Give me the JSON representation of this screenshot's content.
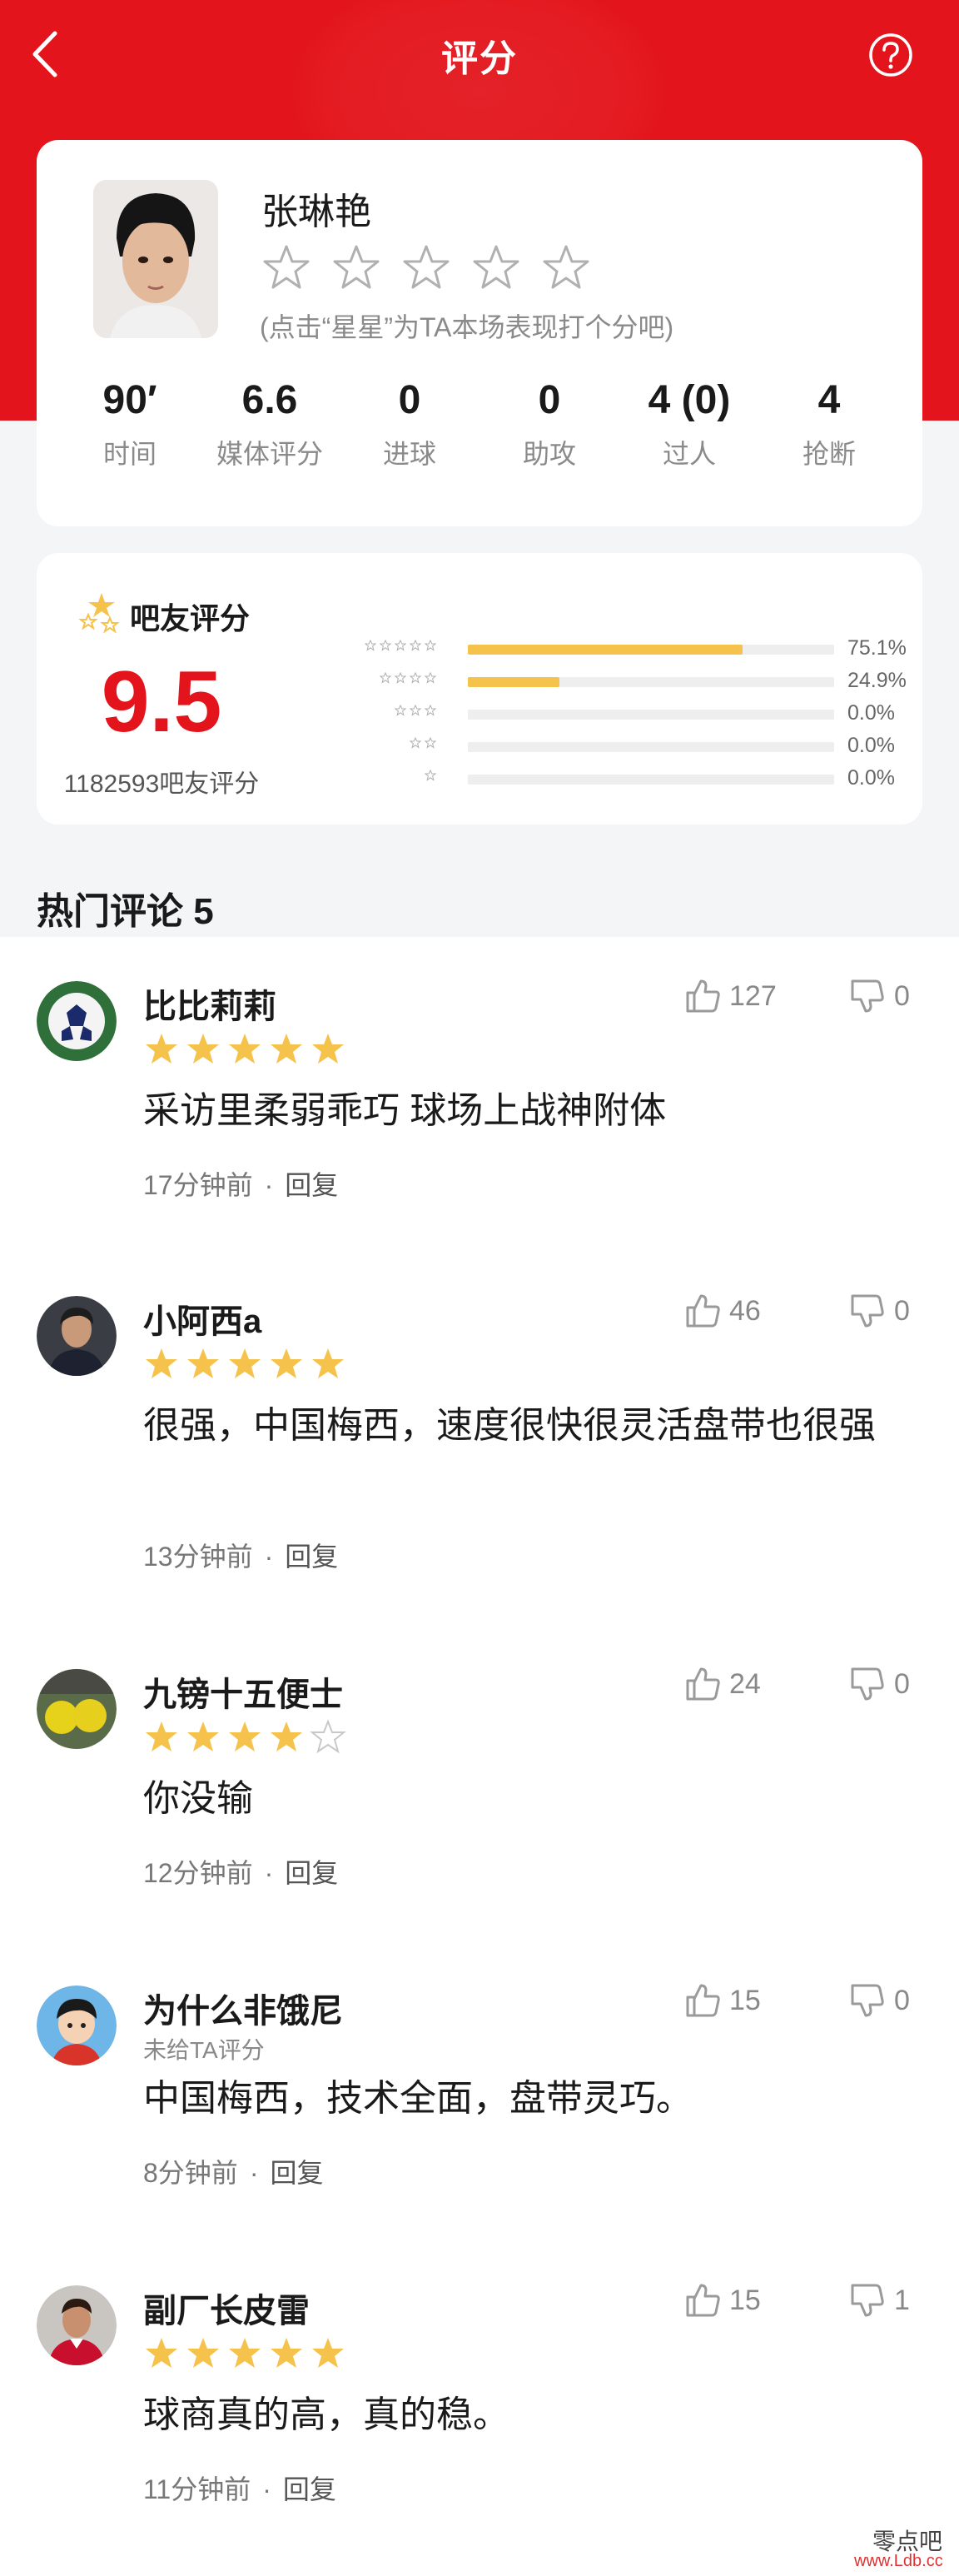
{
  "nav": {
    "title": "评分"
  },
  "player": {
    "name": "张琳艳",
    "hint": "(点击“星星”为TA本场表现打个分吧)",
    "stats": [
      {
        "value": "90′",
        "label": "时间"
      },
      {
        "value": "6.6",
        "label": "媒体评分"
      },
      {
        "value": "0",
        "label": "进球"
      },
      {
        "value": "0",
        "label": "助攻"
      },
      {
        "value": "4 (0)",
        "label": "过人"
      },
      {
        "value": "4",
        "label": "抢断"
      }
    ]
  },
  "fan": {
    "title": "吧友评分",
    "score": "9.5",
    "count": "1182593吧友评分",
    "distribution": [
      {
        "stars": 5,
        "fraction": 0.751,
        "pct": "75.1%"
      },
      {
        "stars": 4,
        "fraction": 0.249,
        "pct": "24.9%"
      },
      {
        "stars": 3,
        "fraction": 0.0,
        "pct": "0.0%"
      },
      {
        "stars": 2,
        "fraction": 0.0,
        "pct": "0.0%"
      },
      {
        "stars": 1,
        "fraction": 0.0,
        "pct": "0.0%"
      }
    ]
  },
  "hot": {
    "title": "热门评论 5"
  },
  "comments": [
    {
      "name": "比比莉莉",
      "rating": 5,
      "text": "采访里柔弱乖巧 球场上战神附体",
      "time": "17分钟前",
      "reply": "回复",
      "likes": "127",
      "dislikes": "0"
    },
    {
      "name": "小阿西a",
      "rating": 5,
      "text": "很强，中国梅西，速度很快很灵活盘带也很强",
      "time": "13分钟前",
      "reply": "回复",
      "likes": "46",
      "dislikes": "0"
    },
    {
      "name": "九镑十五便士",
      "rating": 4,
      "text": "你没输",
      "time": "12分钟前",
      "reply": "回复",
      "likes": "24",
      "dislikes": "0"
    },
    {
      "name": "为什么非饿尼",
      "sub": "未给TA评分",
      "text": "中国梅西，技术全面，盘带灵巧。",
      "time": "8分钟前",
      "reply": "回复",
      "likes": "15",
      "dislikes": "0"
    },
    {
      "name": "副厂长皮雷",
      "rating": 5,
      "text": "球商真的高，真的稳。",
      "time": "11分钟前",
      "reply": "回复",
      "likes": "15",
      "dislikes": "1"
    }
  ],
  "watermark": {
    "name": "零点吧",
    "url": "www.Ldb.cc"
  },
  "colors": {
    "brand_red": "#e3141b",
    "star_gold": "#f5c24b",
    "star_outline": "#b0b0b0"
  },
  "icons": {
    "back": "chevron-left-icon",
    "help": "question-circle-icon",
    "like": "thumb-up-icon",
    "dislike": "thumb-down-icon",
    "fan_rating": "stars-icon"
  }
}
